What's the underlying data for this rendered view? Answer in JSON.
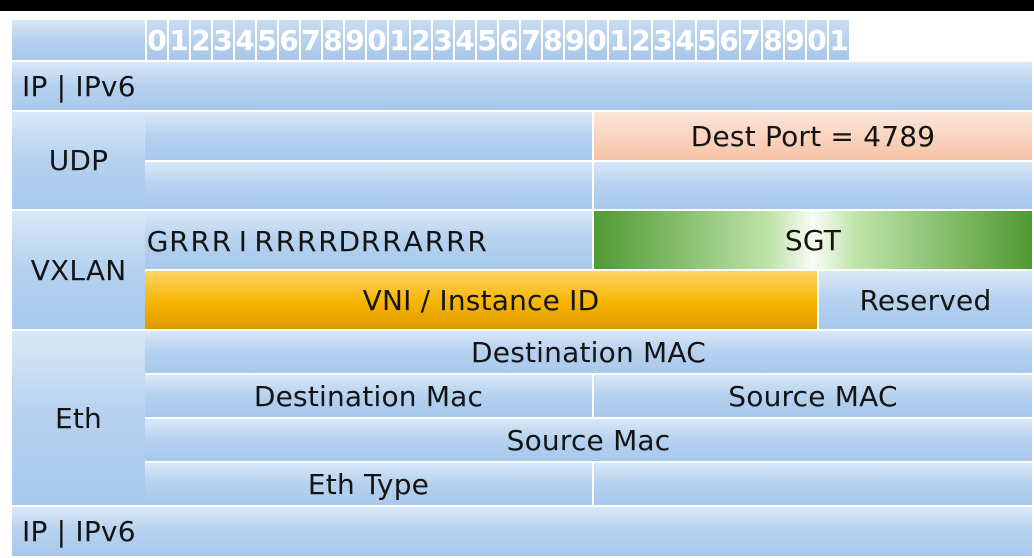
{
  "ruler": [
    "0",
    "1",
    "2",
    "3",
    "4",
    "5",
    "6",
    "7",
    "8",
    "9",
    "0",
    "1",
    "2",
    "3",
    "4",
    "5",
    "6",
    "7",
    "8",
    "9",
    "0",
    "1",
    "2",
    "3",
    "4",
    "5",
    "6",
    "7",
    "8",
    "9",
    "0",
    "1"
  ],
  "layers": {
    "ip_top": "IP | IPv6",
    "udp": "UDP",
    "vxlan": "VXLAN",
    "eth": "Eth",
    "ip_bottom": "IP | IPv6"
  },
  "udp": {
    "dest_port": "Dest Port = 4789"
  },
  "vxlan": {
    "flags": [
      "G",
      "R",
      "R",
      "R",
      "I",
      "R",
      "R",
      "R",
      "R",
      "D",
      "R",
      "R",
      "A",
      "R",
      "R",
      "R"
    ],
    "sgt": "SGT",
    "vni": "VNI / Instance ID",
    "reserved": "Reserved"
  },
  "eth": {
    "destination_mac": "Destination MAC",
    "destination_mac_2": "Destination Mac",
    "source_mac": "Source MAC",
    "source_mac_2": "Source Mac",
    "eth_type": "Eth Type"
  },
  "colors": {
    "field_blue": "#b5d1ef",
    "udp_port": "#f6c2a6",
    "sgt_green": "#4f9a33",
    "vni_gold": "#f7b400"
  }
}
